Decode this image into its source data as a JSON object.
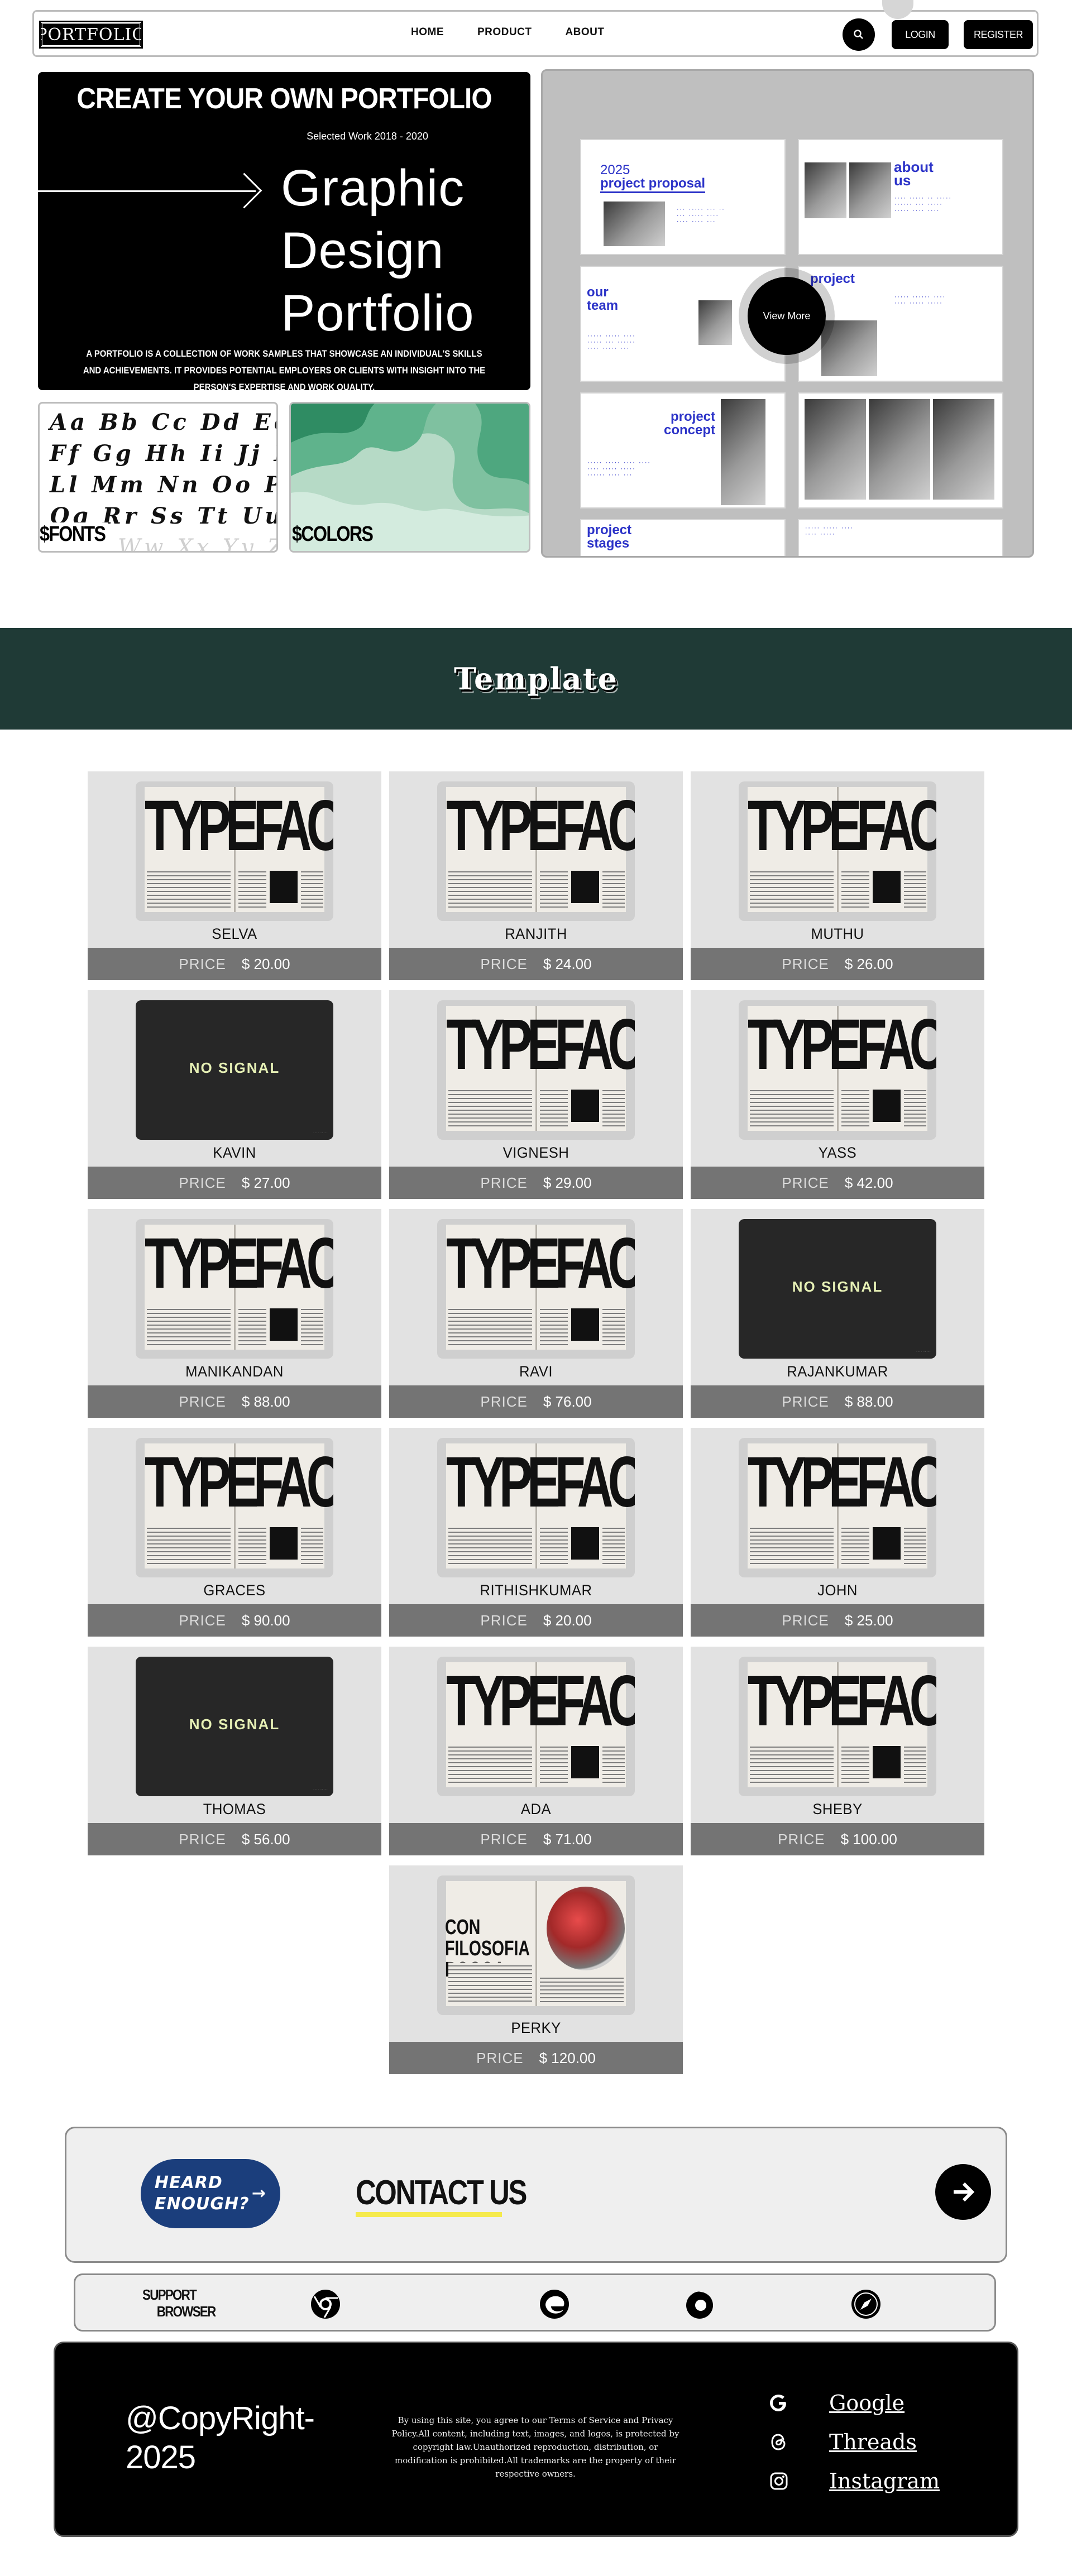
{
  "nav": {
    "logo": "PORTFOLIO",
    "links": [
      "HOME",
      "PRODUCT",
      "ABOUT"
    ],
    "login": "LOGIN",
    "register": "REGISTER",
    "search_icon": "search-icon"
  },
  "hero": {
    "heading": "CREATE YOUR OWN PORTFOLIO",
    "subtitle": "Selected Work 2018 - 2020",
    "title_lines": [
      "Graphic",
      "Design",
      "Portfolio"
    ],
    "description": "A PORTFOLIO IS A COLLECTION OF WORK SAMPLES THAT SHOWCASE AN INDIVIDUAL'S SKILLS AND ACHIEVEMENTS. IT PROVIDES POTENTIAL EMPLOYERS OR CLIENTS WITH INSIGHT INTO THE PERSON'S EXPERTISE AND WORK QUALITY.",
    "fonts_label": "$FONTS",
    "fonts_sample": [
      "Aa Bb Cc Dd Ee",
      "Ff Gg Hh Ii Jj Kk",
      "Ll Mm Nn Oo Pp",
      "Qq Rr Ss Tt Uu"
    ],
    "fonts_ghost": "Ww Xx Yy Zz",
    "colors_label": "$COLORS",
    "view_more": "View More",
    "gallery_titles": [
      "2025",
      "project proposal",
      "about us",
      "our team",
      "project",
      "project concept",
      "project stages"
    ]
  },
  "templates": {
    "heading": "Template",
    "price_label": "PRICE",
    "items": [
      {
        "name": "SELVA",
        "price": "$ 20.00",
        "image": "typeface"
      },
      {
        "name": "RANJITH",
        "price": "$ 24.00",
        "image": "typeface"
      },
      {
        "name": "MUTHU",
        "price": "$ 26.00",
        "image": "typeface"
      },
      {
        "name": "KAVIN",
        "price": "$ 27.00",
        "image": "nosignal"
      },
      {
        "name": "VIGNESH",
        "price": "$ 29.00",
        "image": "typeface"
      },
      {
        "name": "YASS",
        "price": "$ 42.00",
        "image": "typeface"
      },
      {
        "name": "MANIKANDAN",
        "price": "$ 88.00",
        "image": "typeface"
      },
      {
        "name": "RAVI",
        "price": "$ 76.00",
        "image": "typeface"
      },
      {
        "name": "RAJANKUMAR",
        "price": "$ 88.00",
        "image": "nosignal"
      },
      {
        "name": "GRACES",
        "price": "$ 90.00",
        "image": "typeface"
      },
      {
        "name": "RITHISHKUMAR",
        "price": "$ 20.00",
        "image": "typeface"
      },
      {
        "name": "JOHN",
        "price": "$ 25.00",
        "image": "typeface"
      },
      {
        "name": "THOMAS",
        "price": "$ 56.00",
        "image": "nosignal"
      },
      {
        "name": "ADA",
        "price": "$ 71.00",
        "image": "typeface"
      },
      {
        "name": "SHEBY",
        "price": "$ 100.00",
        "image": "typeface"
      },
      {
        "name": "PERKY",
        "price": "$ 120.00",
        "image": "filosofia"
      }
    ],
    "typeface_word": "TYPEFACE",
    "nosignal_text": "NO SIGNAL",
    "filosofia_word": "CON FILOSOFIA BOGOA"
  },
  "contact": {
    "pill_text": "HEARD ENOUGH?",
    "title": "CONTACT US",
    "arrow_icon": "arrow-right-icon",
    "accent": "#f5ea4d",
    "pill_color": "#1b3e7c"
  },
  "support": {
    "label_line1": "SUPPORT",
    "label_line2": "BROWSER",
    "browsers": [
      "chrome-icon",
      "edge-icon",
      "firefox-icon",
      "safari-icon"
    ]
  },
  "footer": {
    "copyright_line1": "@CopyRight-",
    "copyright_line2": "2025",
    "legal": "By using this site, you agree to our Terms of Service and Privacy Policy.All content, including text, images, and logos, is protected by copyright law.Unauthorized reproduction, distribution, or modification is prohibited.All trademarks are the property of their respective owners.",
    "social": [
      {
        "label": "Google",
        "icon": "google-icon"
      },
      {
        "label": "Threads",
        "icon": "threads-icon"
      },
      {
        "label": "Instagram",
        "icon": "instagram-icon"
      }
    ]
  },
  "colors": {
    "band": "#1f3a36",
    "price_bar": "#747474",
    "card_bg": "#e2e2e2"
  }
}
